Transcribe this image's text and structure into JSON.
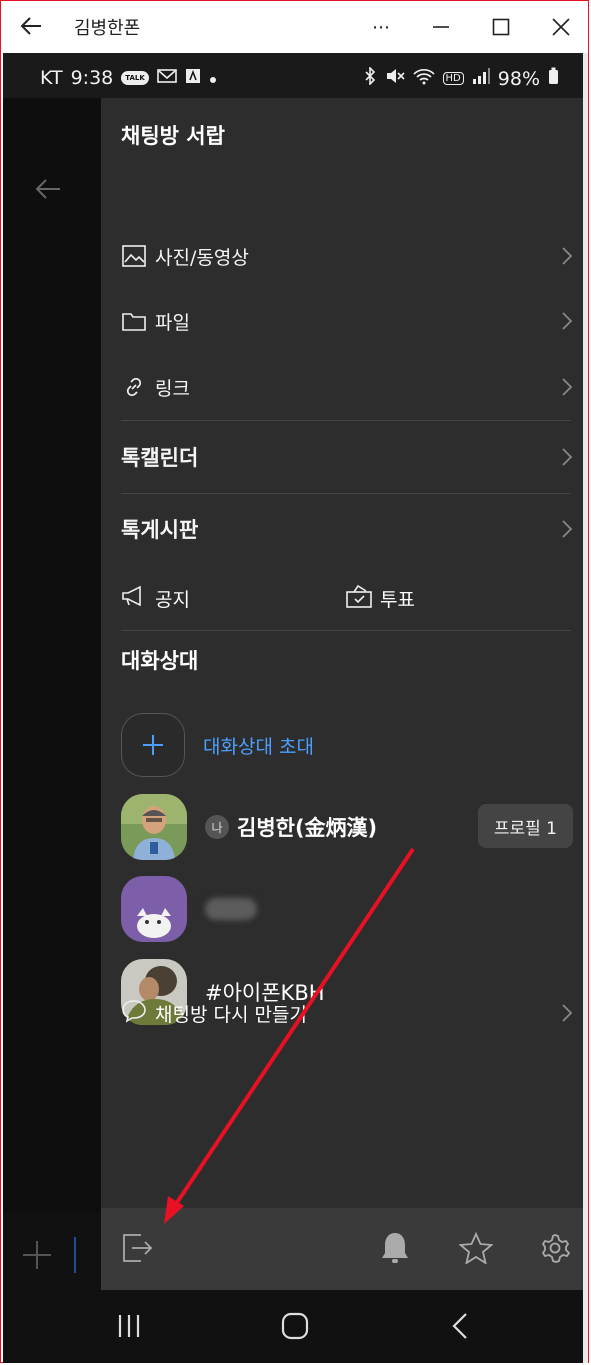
{
  "window": {
    "title": "김병한폰",
    "more_label": "⋯"
  },
  "status": {
    "carrier": "KT",
    "time": "9:38",
    "talk_badge": "TALK",
    "hd": "HD",
    "battery": "98%"
  },
  "drawer": {
    "header": "채팅방 서랍",
    "items": [
      {
        "label": "사진/동영상",
        "icon": "photo-icon"
      },
      {
        "label": "파일",
        "icon": "folder-icon"
      },
      {
        "label": "링크",
        "icon": "link-icon"
      }
    ],
    "talk_calendar": "톡캘린더",
    "talk_board": "톡게시판",
    "notice": "공지",
    "vote": "투표",
    "members_title": "대화상대",
    "invite_label": "대화상대 초대",
    "me_badge": "나",
    "me_name": "김병한(金炳漢)",
    "profile_btn": "프로필 1",
    "member3_name": "#아이폰KBH",
    "recreate_label": "채팅방 다시 만들기"
  },
  "colors": {
    "accent": "#4a9fff",
    "drawer_bg": "#2d2d2d",
    "footer_bg": "#3a3a3a",
    "annotation": "#e81123"
  }
}
